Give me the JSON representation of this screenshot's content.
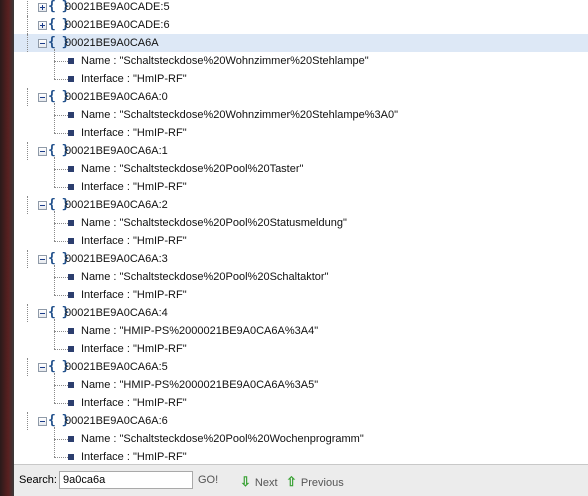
{
  "tree": [
    {
      "label": "00021BE9A0CADE:5",
      "state": "collapsed"
    },
    {
      "label": "00021BE9A0CADE:6",
      "state": "collapsed"
    },
    {
      "label": "00021BE9A0CA6A",
      "state": "expanded",
      "selected": true,
      "children": [
        {
          "label": "Name : \"Schaltsteckdose%20Wohnzimmer%20Stehlampe\""
        },
        {
          "label": "Interface : \"HmIP-RF\""
        }
      ]
    },
    {
      "label": "00021BE9A0CA6A:0",
      "state": "expanded",
      "children": [
        {
          "label": "Name : \"Schaltsteckdose%20Wohnzimmer%20Stehlampe%3A0\""
        },
        {
          "label": "Interface : \"HmIP-RF\""
        }
      ]
    },
    {
      "label": "00021BE9A0CA6A:1",
      "state": "expanded",
      "children": [
        {
          "label": "Name : \"Schaltsteckdose%20Pool%20Taster\""
        },
        {
          "label": "Interface : \"HmIP-RF\""
        }
      ]
    },
    {
      "label": "00021BE9A0CA6A:2",
      "state": "expanded",
      "children": [
        {
          "label": "Name : \"Schaltsteckdose%20Pool%20Statusmeldung\""
        },
        {
          "label": "Interface : \"HmIP-RF\""
        }
      ]
    },
    {
      "label": "00021BE9A0CA6A:3",
      "state": "expanded",
      "children": [
        {
          "label": "Name : \"Schaltsteckdose%20Pool%20Schaltaktor\""
        },
        {
          "label": "Interface : \"HmIP-RF\""
        }
      ]
    },
    {
      "label": "00021BE9A0CA6A:4",
      "state": "expanded",
      "children": [
        {
          "label": "Name : \"HMIP-PS%2000021BE9A0CA6A%3A4\""
        },
        {
          "label": "Interface : \"HmIP-RF\""
        }
      ]
    },
    {
      "label": "00021BE9A0CA6A:5",
      "state": "expanded",
      "children": [
        {
          "label": "Name : \"HMIP-PS%2000021BE9A0CA6A%3A5\""
        },
        {
          "label": "Interface : \"HmIP-RF\""
        }
      ]
    },
    {
      "label": "00021BE9A0CA6A:6",
      "state": "expanded",
      "children": [
        {
          "label": "Name : \"Schaltsteckdose%20Pool%20Wochenprogramm\""
        },
        {
          "label": "Interface : \"HmIP-RF\""
        }
      ]
    }
  ],
  "search": {
    "label": "Search:",
    "value": "9a0ca6a",
    "go_label": "GO!",
    "next_label": "Next",
    "previous_label": "Previous",
    "next_icon": "arrow-down-icon",
    "previous_icon": "arrow-up-icon"
  },
  "colors": {
    "selected_row": "#dde8f6",
    "object_icon": "#1e4e8a",
    "arrow_icon": "#3aa235"
  }
}
